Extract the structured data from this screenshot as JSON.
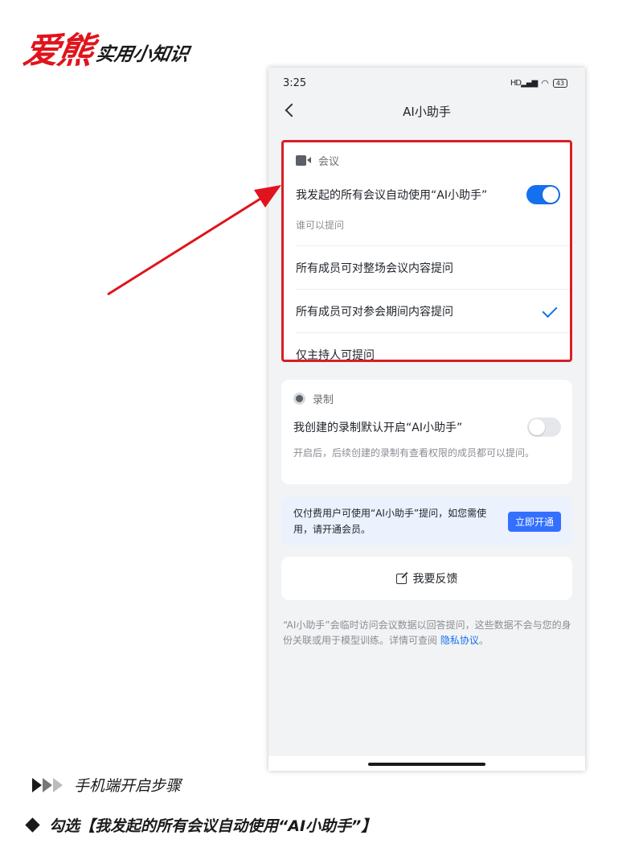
{
  "brand": {
    "main": "爱熊",
    "sub": "实用小知识"
  },
  "status_bar": {
    "time": "3:25",
    "signal": "HD",
    "battery": "43"
  },
  "nav": {
    "title": "AI小助手"
  },
  "meeting_section": {
    "heading": "会议",
    "auto_enable_label": "我发起的所有会议自动使用“AI小助手”",
    "auto_enable_on": true,
    "who_can_ask_label": "谁可以提问",
    "options": [
      {
        "label": "所有成员可对整场会议内容提问",
        "selected": false
      },
      {
        "label": "所有成员可对参会期间内容提问",
        "selected": true
      },
      {
        "label": "仅主持人可提问",
        "selected": false
      }
    ]
  },
  "record_section": {
    "heading": "录制",
    "default_enable_label": "我创建的录制默认开启“AI小助手”",
    "default_enable_on": false,
    "description": "开启后，后续创建的录制有查看权限的成员都可以提问。"
  },
  "promo": {
    "text": "仅付费用户可使用“AI小助手”提问，如您需使用，请开通会员。",
    "button_label": "立即开通"
  },
  "feedback": {
    "label": "我要反馈"
  },
  "disclaimer": {
    "text": "“AI小助手”会临时访问会议数据以回答提问，这些数据不会与您的身份关联或用于模型训练。详情可查阅 ",
    "link": "隐私协议",
    "end": "。"
  },
  "caption": {
    "step_title": "手机端开启步骤",
    "instruction": "勾选【我发起的所有会议自动使用“AI小助手”】"
  },
  "colors": {
    "accent": "#1570ef",
    "highlight_border": "#d81e25",
    "brand_red": "#e0141c"
  }
}
